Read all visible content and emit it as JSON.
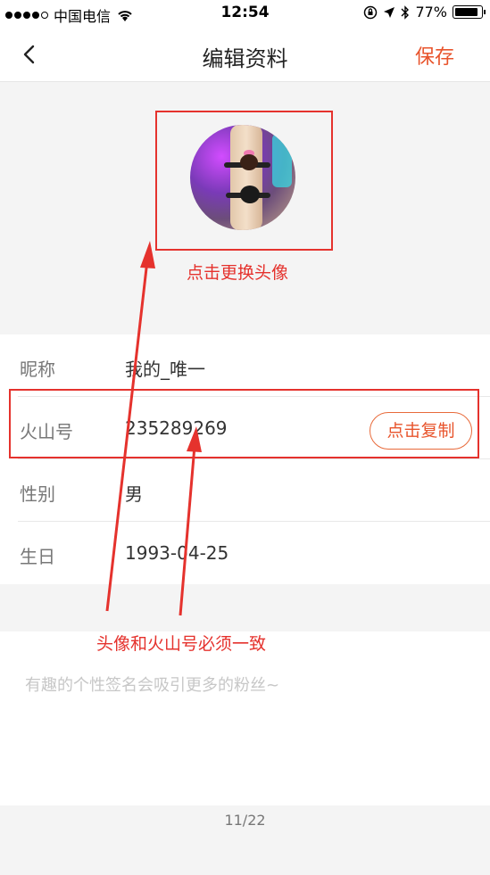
{
  "status_bar": {
    "carrier": "中国电信",
    "time": "12:54",
    "battery": "77%",
    "battery_level": 0.77
  },
  "nav": {
    "title": "编辑资料",
    "save_label": "保存"
  },
  "profile": {
    "nickname_label": "昵称",
    "nickname_value": "我的_唯一",
    "id_label": "火山号",
    "id_value": "235289269",
    "copy_label": "点击复制",
    "gender_label": "性别",
    "gender_value": "男",
    "birthday_label": "生日",
    "birthday_value": "1993-04-25"
  },
  "signature": {
    "placeholder": "有趣的个性签名会吸引更多的粉丝~"
  },
  "page_indicator": "11/22",
  "annotations": {
    "avatar_note": "点击更换头像",
    "match_note": "头像和火山号必须一致"
  },
  "colors": {
    "accent": "#e8542c",
    "annotation": "#e5322d"
  }
}
